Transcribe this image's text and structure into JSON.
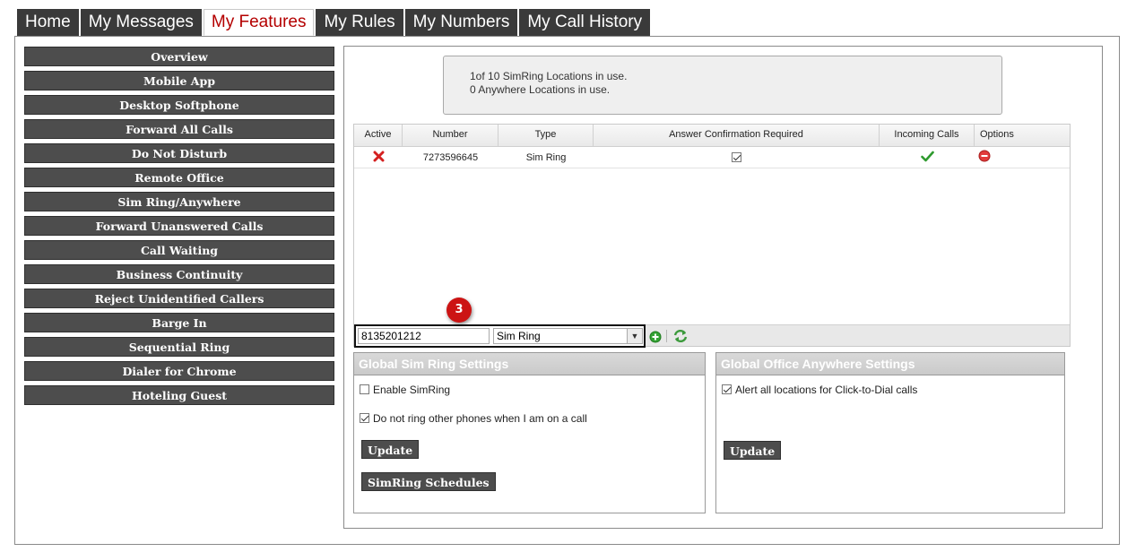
{
  "tabs": [
    {
      "label": "Home"
    },
    {
      "label": "My Messages"
    },
    {
      "label": "My Features"
    },
    {
      "label": "My Rules"
    },
    {
      "label": "My Numbers"
    },
    {
      "label": "My Call History"
    }
  ],
  "sidebar": {
    "items": [
      {
        "label": "Overview"
      },
      {
        "label": "Mobile App"
      },
      {
        "label": "Desktop Softphone"
      },
      {
        "label": "Forward All Calls"
      },
      {
        "label": "Do Not Disturb"
      },
      {
        "label": "Remote Office"
      },
      {
        "label": "Sim Ring/Anywhere"
      },
      {
        "label": "Forward Unanswered Calls"
      },
      {
        "label": "Call Waiting"
      },
      {
        "label": "Business Continuity"
      },
      {
        "label": "Reject Unidentified Callers"
      },
      {
        "label": "Barge In"
      },
      {
        "label": "Sequential Ring"
      },
      {
        "label": "Dialer for Chrome"
      },
      {
        "label": "Hoteling Guest"
      }
    ]
  },
  "info": {
    "line1": "1of 10 SimRing Locations in use.",
    "line2": "0 Anywhere Locations in use."
  },
  "table": {
    "columns": [
      "Active",
      "Number",
      "Type",
      "Answer Confirmation Required",
      "Incoming Calls",
      "Options"
    ],
    "rows": [
      {
        "active": false,
        "number": "7273596645",
        "type": "Sim Ring",
        "answer_confirmation": true,
        "incoming_calls": true
      }
    ]
  },
  "add_form": {
    "number_value": "8135201212",
    "type_value": "Sim Ring"
  },
  "callout": {
    "number": "3"
  },
  "sim_ring": {
    "title": "Global Sim Ring Settings",
    "enable_label": "Enable SimRing",
    "enable_checked": false,
    "dnr_label": "Do not ring other phones when I am on a call",
    "dnr_checked": true,
    "update_label": "Update",
    "schedules_label": "SimRing Schedules"
  },
  "office_anywhere": {
    "title": "Global Office Anywhere Settings",
    "alert_label": "Alert all locations for Click-to-Dial calls",
    "alert_checked": true,
    "update_label": "Update"
  },
  "colors": {
    "accent_red": "#b40000",
    "dark_button": "#4d4d4d",
    "success_green": "#2e9a2e"
  },
  "icons": {
    "inactive": "red-x-icon",
    "incoming_allowed": "green-check-icon",
    "delete": "remove-circle-icon",
    "add": "add-circle-icon",
    "refresh": "refresh-icon"
  }
}
